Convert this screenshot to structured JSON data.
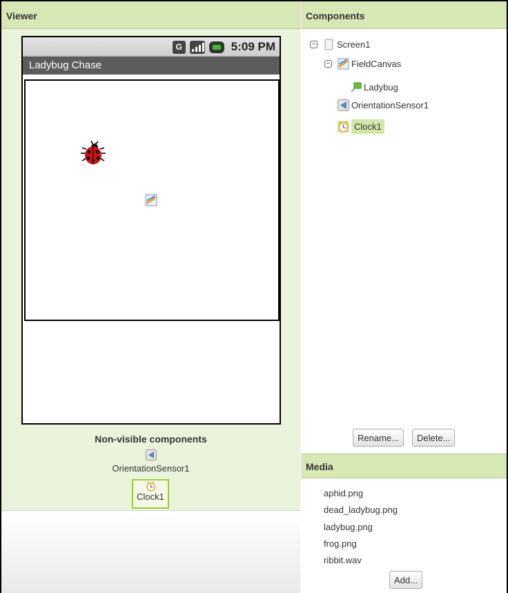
{
  "viewer": {
    "header": "Viewer",
    "phone": {
      "status_time": "5:09 PM",
      "status_network": "G",
      "app_title": "Ladybug Chase"
    },
    "nonvisible": {
      "title": "Non-visible components",
      "items": [
        "OrientationSensor1",
        "Clock1"
      ]
    }
  },
  "components": {
    "header": "Components",
    "tree": [
      {
        "label": "Screen1",
        "icon": "screen-icon"
      },
      {
        "label": "FieldCanvas",
        "icon": "canvas-icon"
      },
      {
        "label": "Ladybug",
        "icon": "imagesprite-icon"
      },
      {
        "label": "OrientationSensor1",
        "icon": "orientation-sensor-icon"
      },
      {
        "label": "Clock1",
        "icon": "clock-icon",
        "selected": true
      }
    ],
    "rename_label": "Rename...",
    "delete_label": "Delete..."
  },
  "media": {
    "header": "Media",
    "files": [
      "aphid.png",
      "dead_ladybug.png",
      "ladybug.png",
      "frog.png",
      "ribbit.wav"
    ],
    "add_label": "Add..."
  },
  "colors": {
    "header_bg": "#d7e8b4",
    "viewer_bg": "#eaf3dc",
    "selected_bg": "#d3e6a9",
    "selected_border": "#9ccb3f"
  }
}
